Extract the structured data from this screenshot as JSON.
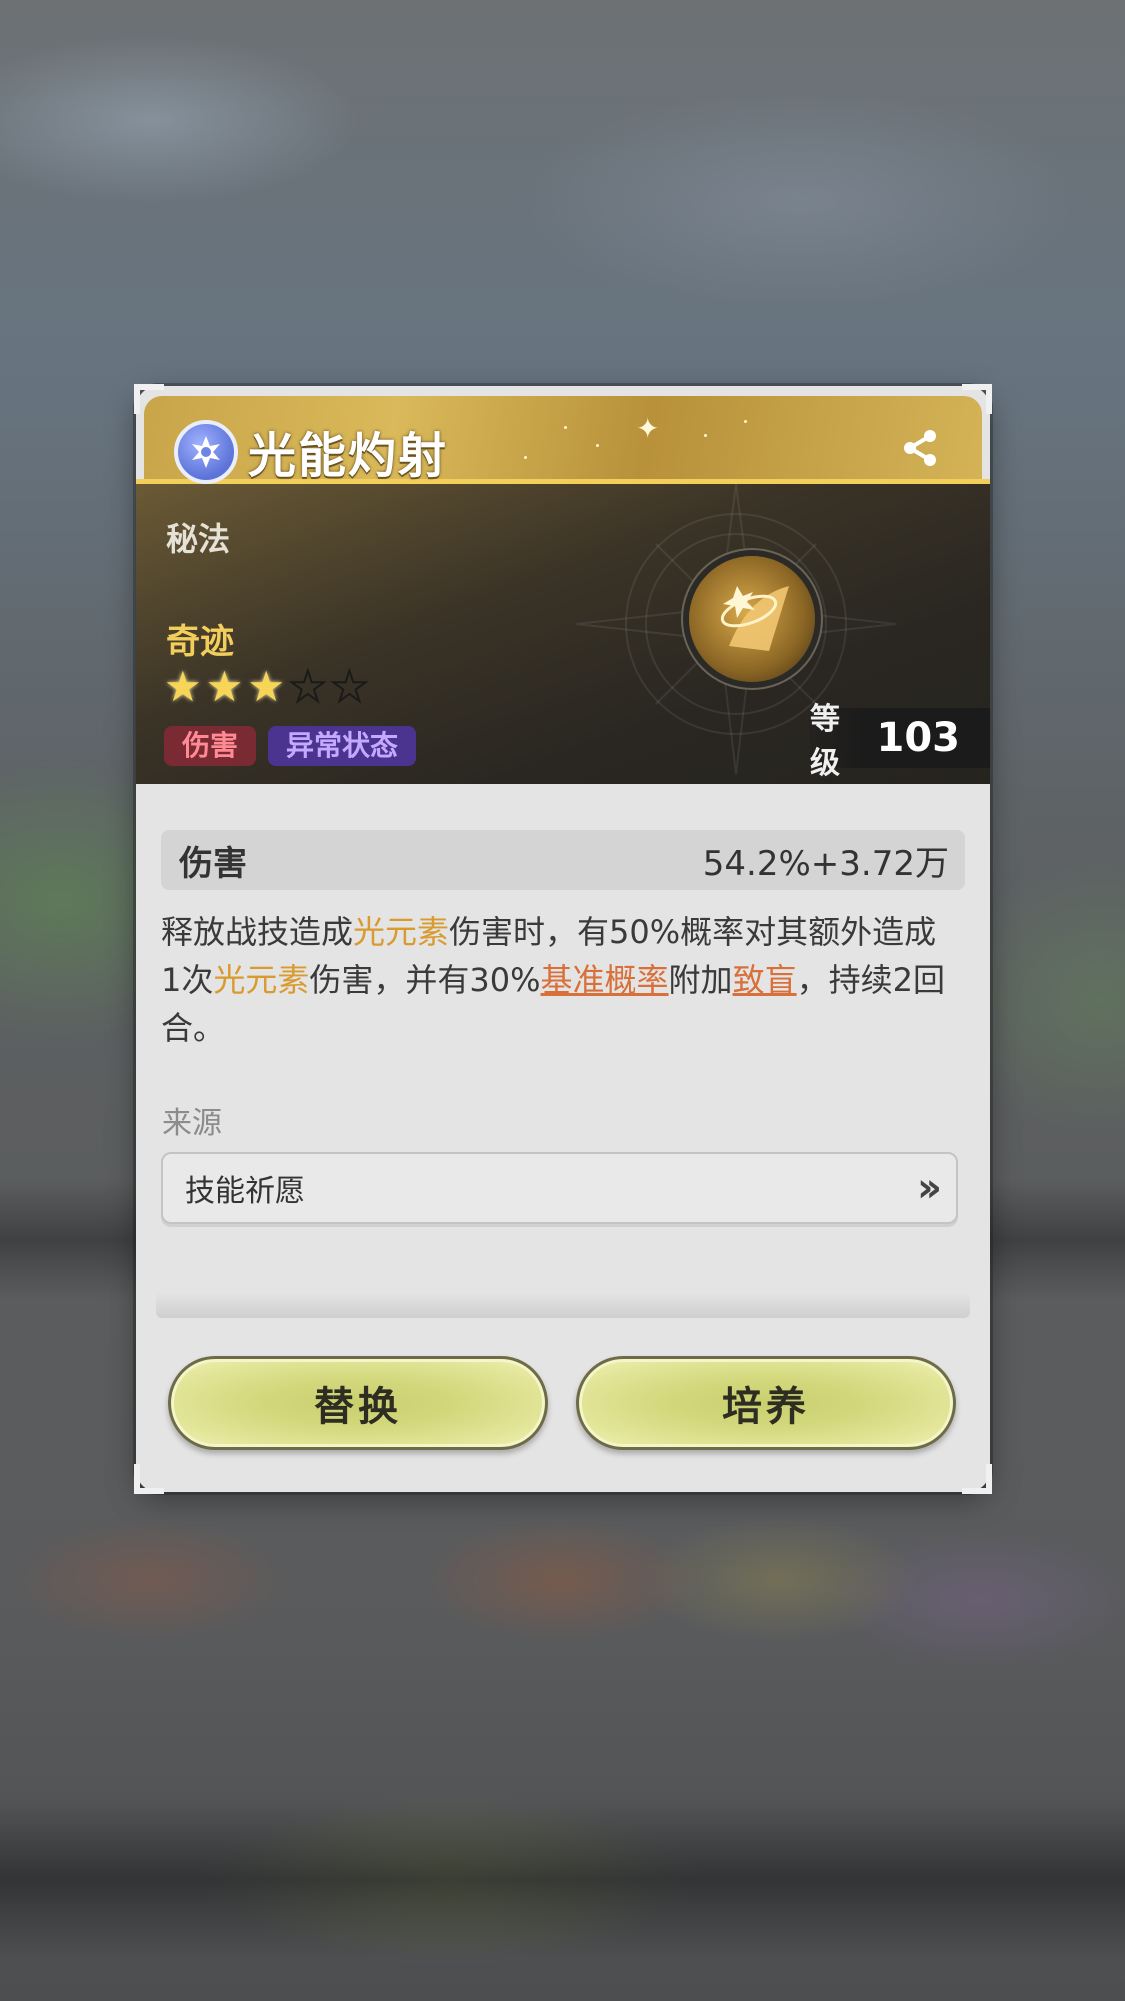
{
  "skill": {
    "name": "光能灼射",
    "category": "秘法",
    "rarity": "奇迹",
    "stars_filled": 3,
    "stars_total": 5,
    "tags": [
      "伤害",
      "异常状态"
    ],
    "level_label": "等级",
    "level_value": "103"
  },
  "stat": {
    "label": "伤害",
    "value": "54.2%+3.72万"
  },
  "description": {
    "p1": "释放战技造成",
    "k1": "光元素",
    "p2": "伤害时，有50%概率对其额外造成1次",
    "k2": "光元素",
    "p3": "伤害，并有30%",
    "link1": "基准概率",
    "p4": "附加",
    "link2": "致盲",
    "p5": "，持续2回合。"
  },
  "source": {
    "label": "来源",
    "value": "技能祈愿"
  },
  "buttons": {
    "replace": "替换",
    "cultivate": "培养"
  },
  "colors": {
    "title_gold": "#d9b95a",
    "highlight_gold": "#d99a2e",
    "link_orange": "#d9703a",
    "button_yellow": "#d4d87e"
  }
}
